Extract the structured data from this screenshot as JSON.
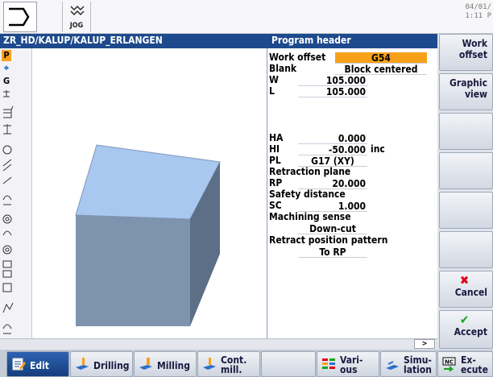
{
  "topbar": {
    "mode_label": "JOG",
    "clock_date": "04/01/",
    "clock_time": "1:11 P"
  },
  "title": {
    "path": "ZR_HD/KALUP/KALUP_ERLANGEN",
    "section": "Program header"
  },
  "strategy_strip": {
    "buttons": [
      "P",
      "G"
    ]
  },
  "params": {
    "work_offset": {
      "label": "Work offset",
      "value": "G54"
    },
    "blank": {
      "label": "Blank",
      "value": "Block centered"
    },
    "w": {
      "label": "W",
      "value": "105.000"
    },
    "l": {
      "label": "L",
      "value": "105.000"
    },
    "ha": {
      "label": "HA",
      "value": "0.000"
    },
    "hi": {
      "label": "HI",
      "value": "-50.000",
      "unit": "inc"
    },
    "pl": {
      "label": "PL",
      "value": "G17 (XY)"
    },
    "retraction_plane": "Retraction plane",
    "rp": {
      "label": "RP",
      "value": "20.000"
    },
    "safety_distance": "Safety distance",
    "sc": {
      "label": "SC",
      "value": "1.000"
    },
    "machining_sense": {
      "label": "Machining sense",
      "value": "Down-cut"
    },
    "retract_pattern": {
      "label": "Retract position pattern",
      "value": "To RP"
    }
  },
  "scroll": {
    "arrow": ">"
  },
  "vertical_softkeys": {
    "work_offset": "Work offset",
    "graphic_view": "Graphic view",
    "cancel": "Cancel",
    "accept": "Accept"
  },
  "horizontal_softkeys": {
    "edit": "Edit",
    "drilling": "Drilling",
    "milling": "Milling",
    "cont_mill_1": "Cont.",
    "cont_mill_2": "mill.",
    "various_1": "Vari-",
    "various_2": "ous",
    "simulation_1": "Simu-",
    "simulation_2": "lation",
    "execute_1": "Ex-",
    "execute_2": "ecute",
    "nc_badge": "NC"
  },
  "colors": {
    "title_bar": "#1d4a8c",
    "highlight": "#f7a11a",
    "block_top": "#a9c8ef",
    "block_front": "#7e93ad",
    "block_side": "#5d6f87"
  },
  "icons": [
    "mode-icon",
    "jog-icon",
    "cancel-x-icon",
    "accept-check-icon",
    "edit-icon",
    "drilling-icon",
    "milling-icon",
    "cont-mill-icon",
    "various-icon",
    "simulation-icon",
    "execute-icon"
  ]
}
